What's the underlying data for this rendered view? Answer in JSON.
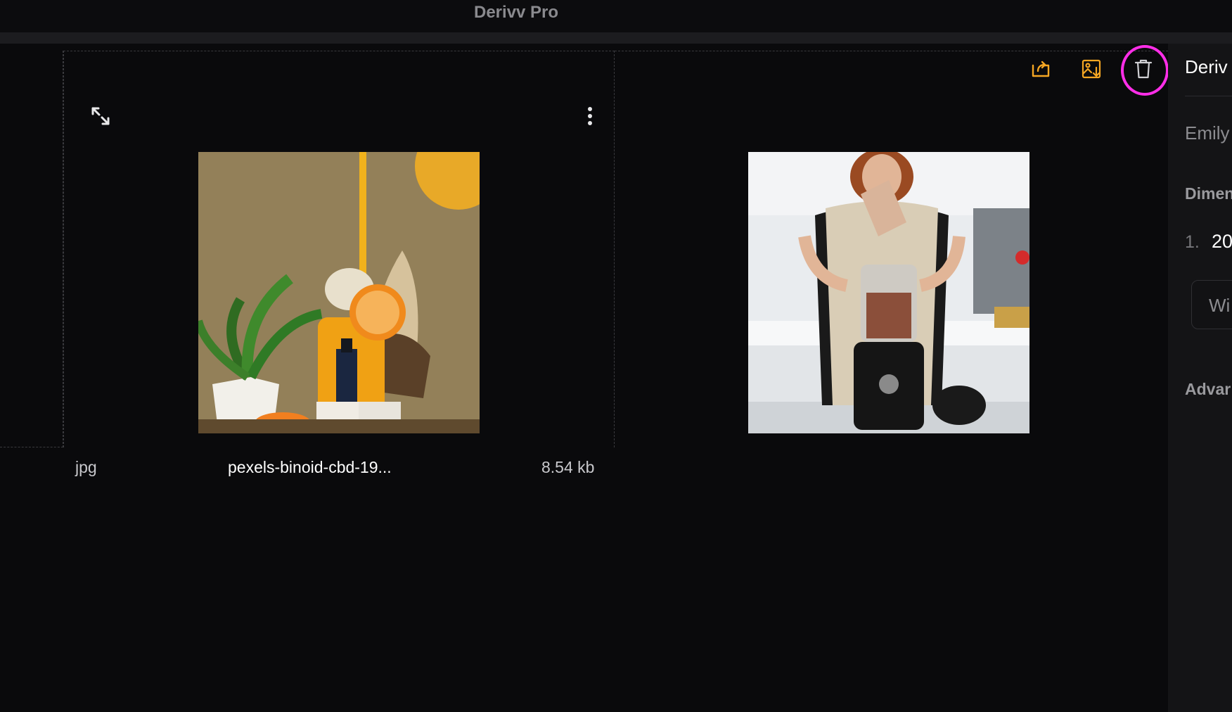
{
  "window": {
    "title": "Derivv Pro"
  },
  "toolbar": {
    "items": [
      {
        "icon": "share-icon"
      },
      {
        "icon": "image-download-icon"
      },
      {
        "icon": "trash-icon"
      }
    ],
    "accent_color": "#f5a623",
    "highlight_color": "#ff2ee8"
  },
  "card": {
    "file_type": "jpg",
    "file_name": "pexels-binoid-cbd-19...",
    "file_size": "8.54 kb"
  },
  "right_panel": {
    "heading": "Deriv",
    "user": "Emily",
    "section_dimensions": "Dimen",
    "dimension_index": "1.",
    "dimension_value": "20",
    "input_placeholder": "Wi",
    "section_advanced": "Advar"
  }
}
